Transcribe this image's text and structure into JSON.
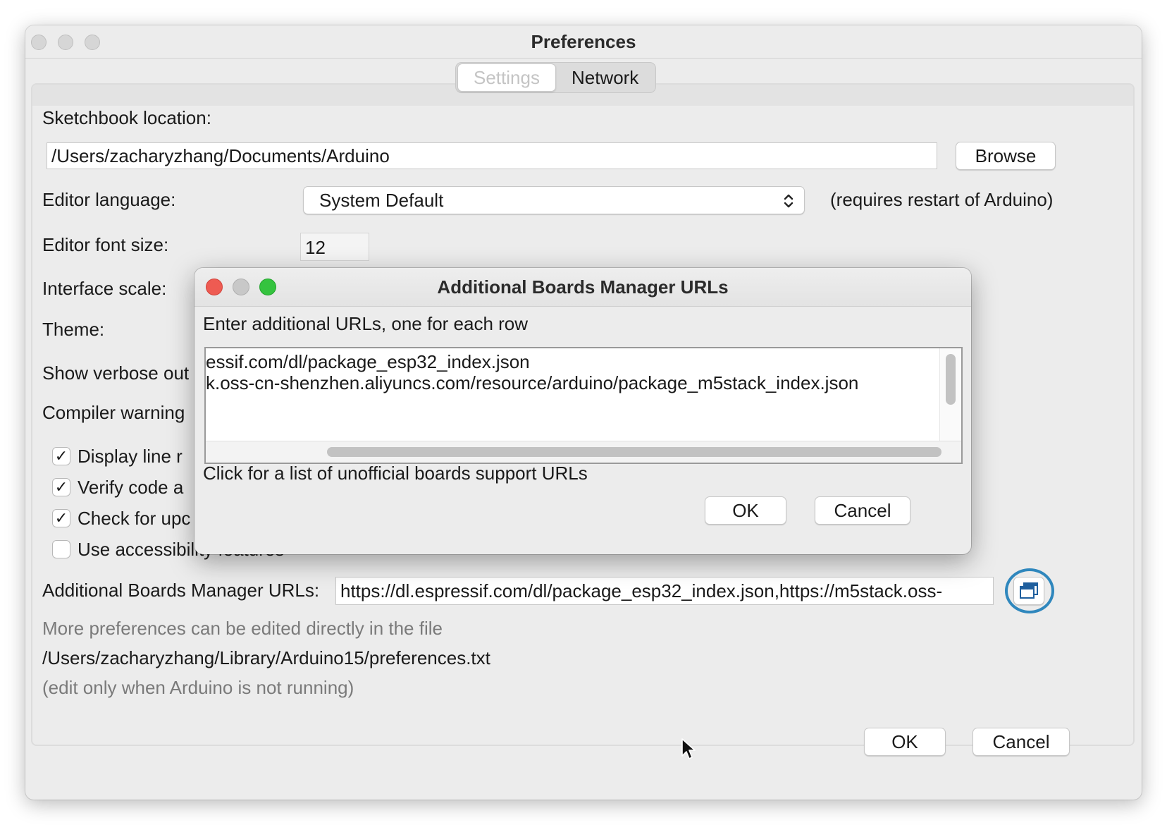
{
  "window": {
    "title": "Preferences"
  },
  "tabs": [
    {
      "label": "Settings",
      "active": true
    },
    {
      "label": "Network",
      "active": false
    }
  ],
  "settings": {
    "sketchbook_label": "Sketchbook location:",
    "sketchbook_path": "/Users/zacharyzhang/Documents/Arduino",
    "browse_label": "Browse",
    "editor_language_label": "Editor language:",
    "editor_language_value": "System Default",
    "language_note": "(requires restart of Arduino)",
    "font_size_label": "Editor font size:",
    "font_size_value": "12",
    "interface_scale_label": "Interface scale:",
    "theme_label": "Theme:",
    "verbose_label": "Show verbose out",
    "compiler_label": "Compiler warning",
    "checkboxes": [
      {
        "label": "Display line r",
        "checked": true
      },
      {
        "label": "Verify code a",
        "checked": true
      },
      {
        "label": "Check for upc",
        "checked": true
      },
      {
        "label": "Use accessibility features",
        "checked": false
      }
    ],
    "boards_urls_label": "Additional Boards Manager URLs:",
    "boards_urls_value": "https://dl.espressif.com/dl/package_esp32_index.json,https://m5stack.oss-",
    "more_prefs_note": "More preferences can be edited directly in the file",
    "prefs_file_path": "/Users/zacharyzhang/Library/Arduino15/preferences.txt",
    "edit_note": "(edit only when Arduino is not running)"
  },
  "footer": {
    "ok_label": "OK",
    "cancel_label": "Cancel"
  },
  "dialog": {
    "title": "Additional Boards Manager URLs",
    "instruction": "Enter additional URLs, one for each row",
    "url_rows": [
      "essif.com/dl/package_esp32_index.json",
      "k.oss-cn-shenzhen.aliyuncs.com/resource/arduino/package_m5stack_index.json"
    ],
    "link_text": "Click for a list of unofficial boards support URLs",
    "ok_label": "OK",
    "cancel_label": "Cancel"
  },
  "icons": {
    "window_open_button": "window-stack-icon",
    "pointer": "mouse-pointer-icon"
  },
  "colors": {
    "highlight_ring": "#2f87bd",
    "close_red": "#ee5b52",
    "maximize_green": "#35c33f",
    "minimize_gray": "#c8c8c8"
  }
}
